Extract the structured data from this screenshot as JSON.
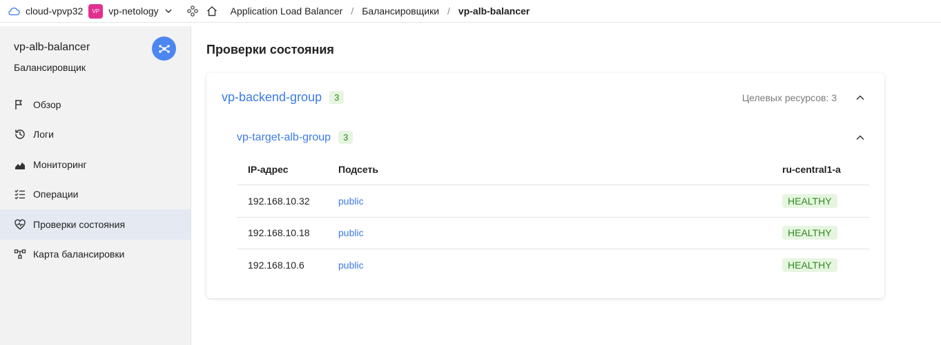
{
  "topbar": {
    "cloud_label": "cloud-vpvp32",
    "folder_badge": "VP",
    "folder_label": "vp-netology",
    "breadcrumbs": [
      "Application Load Balancer",
      "Балансировщики",
      "vp-alb-balancer"
    ],
    "separator": "/"
  },
  "sidebar": {
    "title": "vp-alb-balancer",
    "subtitle": "Балансировщик",
    "items": [
      {
        "label": "Обзор",
        "icon": "flag-icon"
      },
      {
        "label": "Логи",
        "icon": "history-icon"
      },
      {
        "label": "Мониторинг",
        "icon": "chart-icon"
      },
      {
        "label": "Операции",
        "icon": "checklist-icon"
      },
      {
        "label": "Проверки состояния",
        "icon": "heart-pulse-icon",
        "active": true
      },
      {
        "label": "Карта балансировки",
        "icon": "topology-icon"
      }
    ]
  },
  "main": {
    "title": "Проверки состояния",
    "backend_group": {
      "name": "vp-backend-group",
      "count": "3",
      "resources": "Целевых ресурсов: 3"
    },
    "target_group": {
      "name": "vp-target-alb-group",
      "count": "3"
    },
    "table": {
      "headers": [
        "IP-адрес",
        "Подсеть",
        "ru-central1-a"
      ],
      "rows": [
        {
          "ip": "192.168.10.32",
          "subnet": "public",
          "status": "HEALTHY"
        },
        {
          "ip": "192.168.10.18",
          "subnet": "public",
          "status": "HEALTHY"
        },
        {
          "ip": "192.168.10.6",
          "subnet": "public",
          "status": "HEALTHY"
        }
      ]
    }
  },
  "colors": {
    "accent": "#3b7be6",
    "healthy_bg": "#e6f5e0",
    "healthy_text": "#2f8a1f",
    "folder_badge": "#e2308f",
    "service_icon_bg": "#4c86f0"
  }
}
